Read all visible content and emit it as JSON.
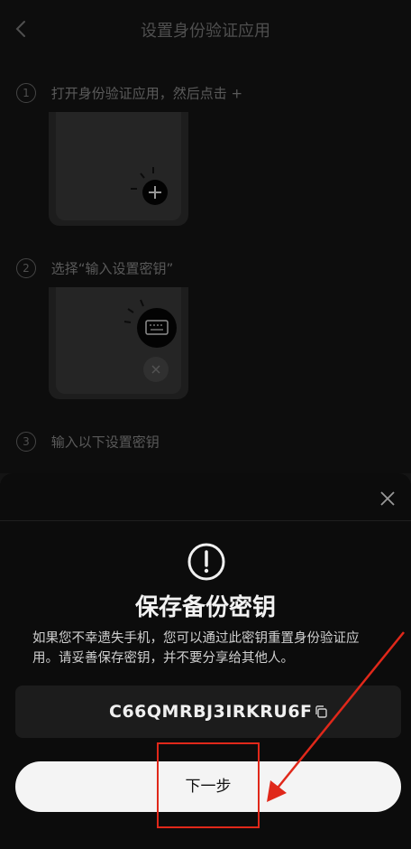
{
  "header": {
    "title": "设置身份验证应用",
    "back_icon": "back-arrow-icon"
  },
  "steps": [
    {
      "num": "1",
      "label": "打开身份验证应用，然后点击 +"
    },
    {
      "num": "2",
      "label": "选择“输入设置密钥”"
    },
    {
      "num": "3",
      "label": "输入以下设置密钥"
    }
  ],
  "sheet": {
    "title": "保存备份密钥",
    "description": "如果您不幸遗失手机，您可以通过此密钥重置身份验证应用。请妥善保存密钥，并不要分享给其他人。",
    "key": "C66QMRBJ3IRKRU6F",
    "next_label": "下一步"
  },
  "colors": {
    "background": "#141414",
    "sheet": "#0c0c0c",
    "button": "#f4f4f4",
    "annotation": "#e0281a"
  }
}
